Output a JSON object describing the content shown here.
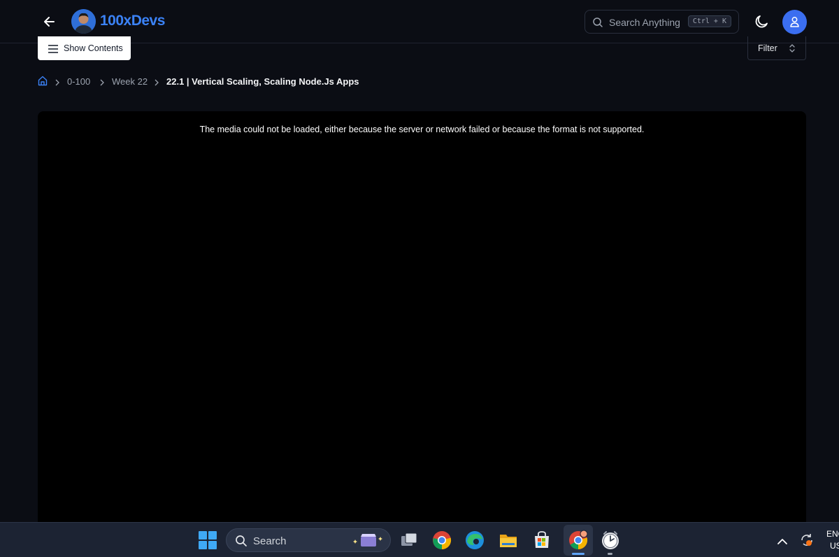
{
  "app": {
    "brand_name": "100xDevs",
    "accent_color": "#3b82f6"
  },
  "header": {
    "search_placeholder": "Search Anything",
    "search_shortcut": "Ctrl + K",
    "icons": [
      "arrow-left-icon",
      "logo-avatar",
      "search-icon",
      "moon-icon",
      "user-icon"
    ]
  },
  "toolbar": {
    "show_contents_label": "Show Contents",
    "filter_label": "Filter"
  },
  "breadcrumb": {
    "items": [
      "0-100",
      "Week 22",
      "22.1 | Vertical Scaling, Scaling Node.Js Apps"
    ]
  },
  "player": {
    "error_message": "The media could not be loaded, either because the server or network failed or because the format is not supported."
  },
  "taskbar": {
    "search_label": "Search",
    "language_line1": "ENG",
    "language_line2": "US",
    "apps": [
      "start-icon",
      "search-icon",
      "task-view-icon",
      "chrome-icon",
      "edge-icon",
      "file-explorer-icon",
      "microsoft-store-icon",
      "chrome-profile-icon",
      "clock-app-icon"
    ]
  }
}
